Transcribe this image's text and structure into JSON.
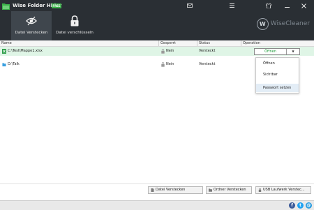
{
  "app": {
    "title": "Wise Folder Hider",
    "badge": "FREE"
  },
  "window_controls": [
    "mail-icon",
    "menu-icon",
    "shirt-icon",
    "minimize-icon",
    "close-icon"
  ],
  "tabs": [
    {
      "label": "Datei Verstecken",
      "active": true,
      "icon": "eye-slash-icon"
    },
    {
      "label": "Datei verschlüsseln",
      "active": false,
      "icon": "lock-icon"
    }
  ],
  "brand": {
    "logo": "W",
    "text": "WiseCleaner"
  },
  "table": {
    "columns": [
      "Name",
      "Gesperrt",
      "Status",
      "Operation"
    ],
    "rows": [
      {
        "name": "C:\\Test\\Mappe1.xlsx",
        "locked": "Nein",
        "status": "Versteckt",
        "operation": "Öffnen",
        "selected": true,
        "icon": "excel-file-icon"
      },
      {
        "name": "D:\\Talk",
        "locked": "Nein",
        "status": "Versteckt",
        "operation": "",
        "selected": false,
        "icon": "folder-icon"
      }
    ]
  },
  "dropdown": {
    "items": [
      "Öffnen",
      "Sichtbar",
      "Passwort setzen"
    ],
    "hovered_index": 2
  },
  "buttons": [
    {
      "label": "Datei Verstecken",
      "icon": "file-icon"
    },
    {
      "label": "Ordner Verstecken",
      "icon": "folder-icon"
    },
    {
      "label": "USB Laufwerk Verstec...",
      "icon": "usb-icon"
    }
  ],
  "social": [
    {
      "name": "facebook-icon",
      "glyph": "f",
      "color": "#3b5998"
    },
    {
      "name": "twitter-icon",
      "glyph": "t",
      "color": "#1da1f2"
    },
    {
      "name": "email-icon",
      "glyph": "@",
      "color": "#2b9de0"
    }
  ],
  "colors": {
    "header_bg": "#2a2f34",
    "tab_active": "#3f464d",
    "accent_green": "#3cb34a",
    "selected_row": "#dff5e6",
    "operation_text": "#1e9c3a"
  }
}
